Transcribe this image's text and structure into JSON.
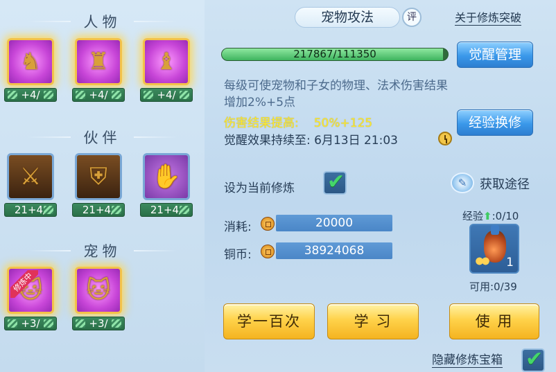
{
  "left": {
    "sections": {
      "people": "人物",
      "partners": "伙伴",
      "pets": "宠物"
    },
    "people_slots": [
      {
        "name": "slot-person-1",
        "level": "+4/",
        "glyph": "♞"
      },
      {
        "name": "slot-person-2",
        "level": "+4/",
        "glyph": "♜"
      },
      {
        "name": "slot-person-3",
        "level": "+4/",
        "glyph": "♝"
      }
    ],
    "partner_slots": [
      {
        "name": "slot-partner-1",
        "level": "21+4/",
        "glyph": "⚔"
      },
      {
        "name": "slot-partner-2",
        "level": "21+4/",
        "glyph": "⛨"
      },
      {
        "name": "slot-partner-3",
        "level": "21+4/",
        "glyph": "✋"
      }
    ],
    "pet_slots": [
      {
        "name": "slot-pet-1",
        "level": "+3/",
        "glyph": "🐱",
        "badge": "修炼中"
      },
      {
        "name": "slot-pet-2",
        "level": "+3/",
        "glyph": "🐱"
      }
    ]
  },
  "header": {
    "title": "宠物攻法",
    "rate_icon": "评",
    "about_link": "关于修炼突破"
  },
  "progress": {
    "text": "217867/111350",
    "fill_fraction": 0.98
  },
  "buttons": {
    "awaken_manage": "觉醒管理",
    "exp_exchange": "经验换修",
    "learn_hundred": "学一百次",
    "learn": "学 习",
    "use": "使 用"
  },
  "description": "每级可使宠物和子女的物理、法术伤害结果增加2%+5点",
  "damage": {
    "label": "伤害结果提高:",
    "value": "50%+125"
  },
  "duration": "觉醒效果持续至:  6月13日 21:03",
  "set_current": {
    "label": "设为当前修炼",
    "checked": true
  },
  "acquire": {
    "label": "获取途径"
  },
  "costs": {
    "consume_label": "消耗:",
    "consume_value": "20000",
    "copper_label": "铜币:",
    "copper_value": "38924068"
  },
  "item": {
    "exp_label": "经验",
    "exp_value": ":0/10",
    "count": "1",
    "available": "可用:0/39"
  },
  "hide_chest": {
    "label": "隐藏修炼宝箱",
    "checked": true
  },
  "colors": {
    "gold_glow": "#f3c24a",
    "blue_button": "#3a98ea",
    "yellow_button": "#ffd24a",
    "damage_text": "#ffea2d",
    "progress_fill": "#3fb45f"
  }
}
